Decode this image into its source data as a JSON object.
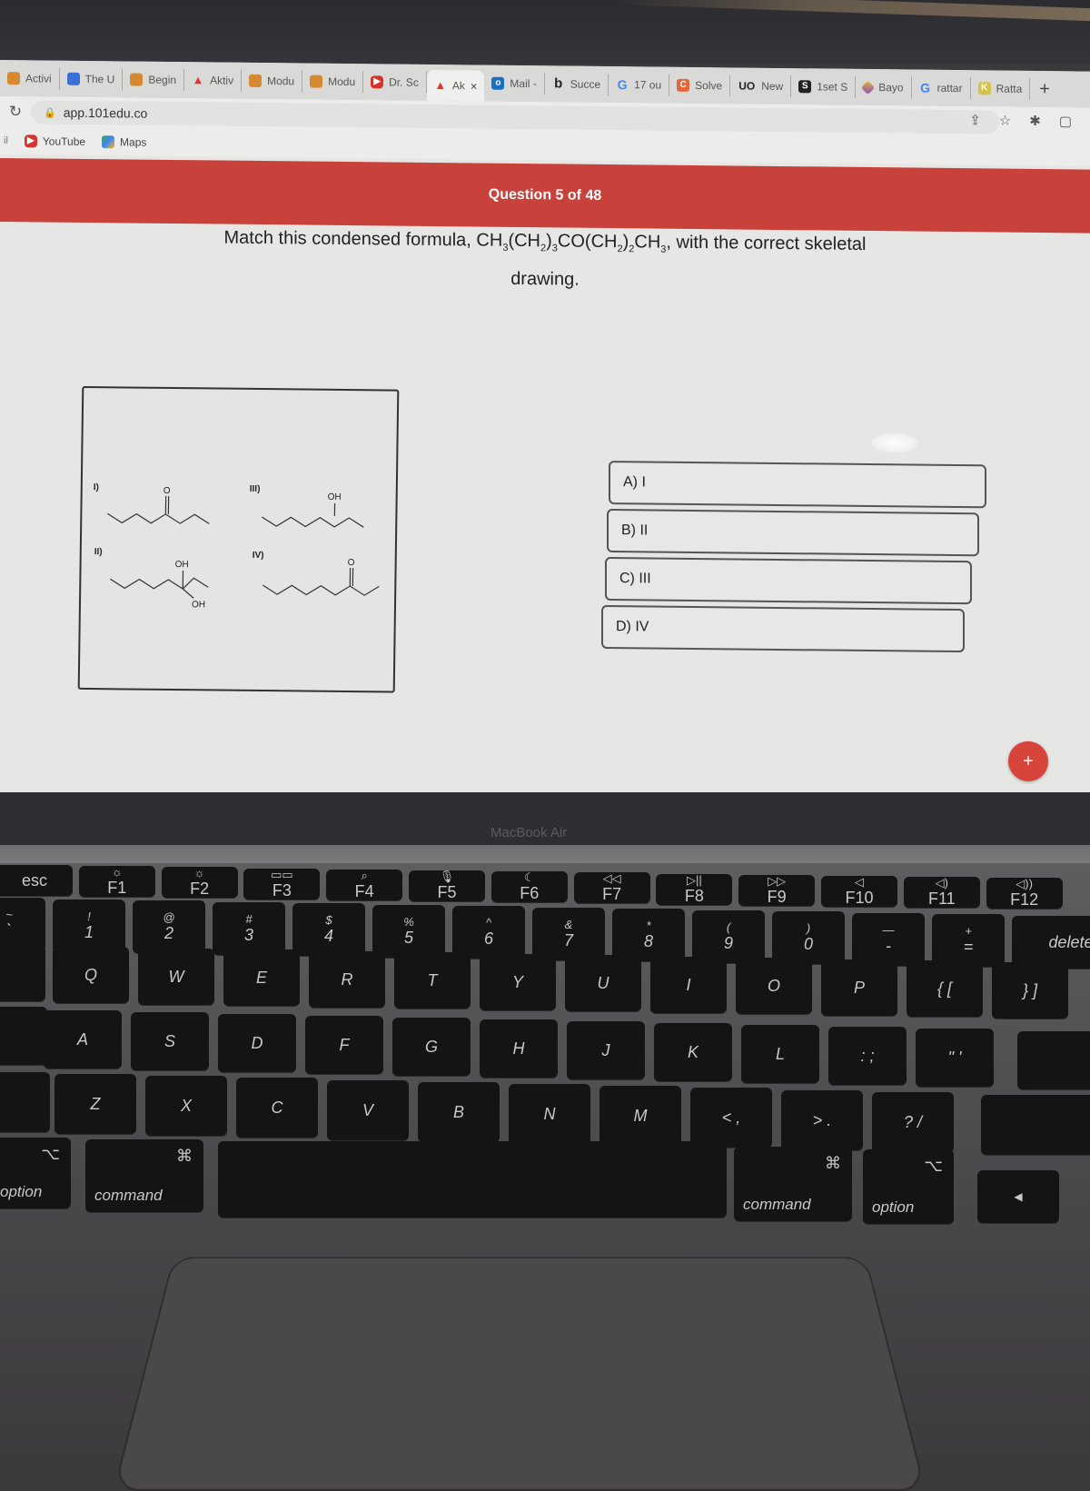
{
  "browser": {
    "tabs": [
      {
        "label": "Activi",
        "icon": "pencil-icon"
      },
      {
        "label": "The U",
        "icon": "doc-icon"
      },
      {
        "label": "Begin",
        "icon": "pencil-icon"
      },
      {
        "label": "Aktiv",
        "icon": "aktiv-icon"
      },
      {
        "label": "Modu",
        "icon": "pencil-icon"
      },
      {
        "label": "Modu",
        "icon": "pencil-icon"
      },
      {
        "label": "Dr. Sc",
        "icon": "youtube-icon"
      },
      {
        "label": "Ak",
        "icon": "aktiv-icon",
        "active": true
      },
      {
        "label": "Mail -",
        "icon": "outlook-icon"
      },
      {
        "label": "Succe",
        "icon": "b-icon"
      },
      {
        "label": "17 ou",
        "icon": "google-icon"
      },
      {
        "label": "Solve",
        "icon": "chegg-icon"
      },
      {
        "label": "New",
        "icon": "uo-icon"
      },
      {
        "label": "1set S",
        "icon": "s-icon"
      },
      {
        "label": "Bayo",
        "icon": "bayo-icon"
      },
      {
        "label": "rattar",
        "icon": "google-icon"
      },
      {
        "label": "Ratta",
        "icon": "k-icon"
      }
    ],
    "tab_close": "×",
    "new_tab": "+",
    "url": "app.101edu.co",
    "bookmarks": [
      {
        "label": "YouTube",
        "icon": "youtube-icon"
      },
      {
        "label": "Maps",
        "icon": "maps-icon"
      }
    ],
    "apps_stub": "il"
  },
  "quiz": {
    "progress": "Question 5 of 48",
    "question_prefix": "Match this condensed formula, ",
    "formula_parts": [
      "CH",
      "3",
      "(CH",
      "2",
      ")",
      "3",
      "CO(CH",
      "2",
      ")",
      "2",
      "CH",
      "3"
    ],
    "question_suffix": ", with the correct skeletal drawing.",
    "structures": [
      {
        "label": "I)",
        "substituents": [
          "O"
        ]
      },
      {
        "label": "II)",
        "substituents": [
          "OH",
          "OH"
        ]
      },
      {
        "label": "III)",
        "substituents": [
          "OH"
        ]
      },
      {
        "label": "IV)",
        "substituents": [
          "O"
        ]
      }
    ],
    "options": [
      {
        "letter": "A)",
        "text": "I"
      },
      {
        "letter": "B)",
        "text": "II"
      },
      {
        "letter": "C)",
        "text": "III"
      },
      {
        "letter": "D)",
        "text": "IV"
      }
    ],
    "fab_label": "+"
  },
  "laptop": {
    "brand": "MacBook Air",
    "fn_row": [
      {
        "top": "",
        "bot": "esc"
      },
      {
        "top": "☼",
        "bot": "F1"
      },
      {
        "top": "☼",
        "bot": "F2"
      },
      {
        "top": "▭▭",
        "bot": "F3"
      },
      {
        "top": "⌕",
        "bot": "F4"
      },
      {
        "top": "🎙",
        "bot": "F5"
      },
      {
        "top": "☾",
        "bot": "F6"
      },
      {
        "top": "◁◁",
        "bot": "F7"
      },
      {
        "top": "▷||",
        "bot": "F8"
      },
      {
        "top": "▷▷",
        "bot": "F9"
      },
      {
        "top": "◁",
        "bot": "F10"
      },
      {
        "top": "◁)",
        "bot": "F11"
      },
      {
        "top": "◁))",
        "bot": "F12"
      }
    ],
    "number_row": [
      {
        "top": "~",
        "bot": "`"
      },
      {
        "top": "!",
        "bot": "1"
      },
      {
        "top": "@",
        "bot": "2"
      },
      {
        "top": "#",
        "bot": "3"
      },
      {
        "top": "$",
        "bot": "4"
      },
      {
        "top": "%",
        "bot": "5"
      },
      {
        "top": "^",
        "bot": "6"
      },
      {
        "top": "&",
        "bot": "7"
      },
      {
        "top": "*",
        "bot": "8"
      },
      {
        "top": "(",
        "bot": "9"
      },
      {
        "top": ")",
        "bot": "0"
      },
      {
        "top": "—",
        "bot": "-"
      },
      {
        "top": "+",
        "bot": "="
      },
      {
        "top": "",
        "bot": "delete"
      }
    ],
    "qwerty_row": [
      "Q",
      "W",
      "E",
      "R",
      "T",
      "Y",
      "U",
      "I",
      "O",
      "P",
      "{ [",
      "} ]"
    ],
    "home_row": [
      "A",
      "S",
      "D",
      "F",
      "G",
      "H",
      "J",
      "K",
      "L",
      ": ;",
      "\" '"
    ],
    "bottom_row": [
      "Z",
      "X",
      "C",
      "V",
      "B",
      "N",
      "M",
      "< ,",
      "> .",
      "? /"
    ],
    "modifiers": {
      "option_left": "option",
      "option_symbol": "⌥",
      "command_left": "command",
      "command_symbol": "⌘",
      "command_right": "command",
      "option_right": "option",
      "arrow_left": "◀"
    }
  }
}
